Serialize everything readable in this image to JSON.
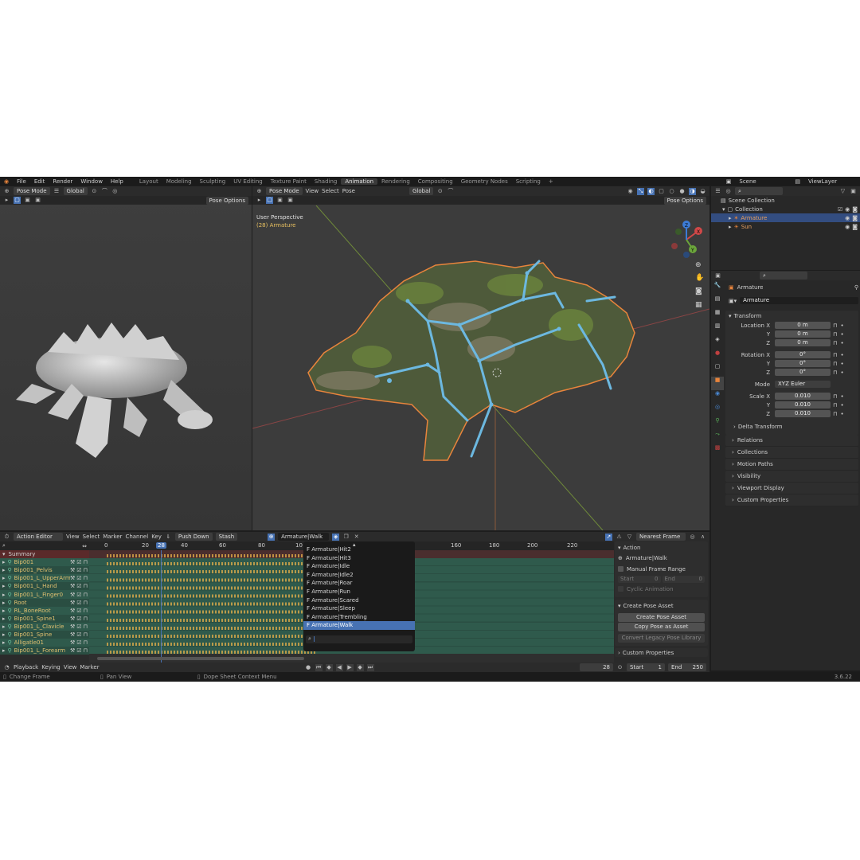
{
  "menu": {
    "items": [
      "File",
      "Edit",
      "Render",
      "Window",
      "Help"
    ],
    "workspaces": [
      "Layout",
      "Modeling",
      "Sculpting",
      "UV Editing",
      "Texture Paint",
      "Shading",
      "Animation",
      "Rendering",
      "Compositing",
      "Geometry Nodes",
      "Scripting"
    ],
    "active_workspace": "Animation",
    "plus": "+",
    "scene": "Scene",
    "view_layer": "ViewLayer"
  },
  "left_view": {
    "mode": "Pose Mode",
    "orientation": "Global",
    "pose_options": "Pose Options"
  },
  "main_view": {
    "mode": "Pose Mode",
    "menus": [
      "View",
      "Select",
      "Pose"
    ],
    "orientation": "Global",
    "pose_options": "Pose Options",
    "perspective": "User Perspective",
    "object_label": "(28) Armature",
    "axis": {
      "x": "X",
      "y": "Y",
      "z": "Z"
    }
  },
  "outliner": {
    "scene_collection": "Scene Collection",
    "collection": "Collection",
    "items": [
      "Armature",
      "Sun"
    ]
  },
  "properties": {
    "object_name": "Armature",
    "data_name": "Armature",
    "transform_title": "Transform",
    "location": {
      "label": "Location X",
      "y": "Y",
      "z": "Z",
      "values": [
        "0 m",
        "0 m",
        "0 m"
      ]
    },
    "rotation": {
      "label": "Rotation X",
      "y": "Y",
      "z": "Z",
      "values": [
        "0°",
        "0°",
        "0°"
      ]
    },
    "mode_label": "Mode",
    "mode_value": "XYZ Euler",
    "scale": {
      "label": "Scale X",
      "y": "Y",
      "z": "Z",
      "values": [
        "0.010",
        "0.010",
        "0.010"
      ]
    },
    "panels": [
      "Delta Transform",
      "Relations",
      "Collections",
      "Motion Paths",
      "Visibility",
      "Viewport Display",
      "Custom Properties"
    ]
  },
  "dopesheet": {
    "editor": "Action Editor",
    "menus": [
      "View",
      "Select",
      "Marker",
      "Channel",
      "Key"
    ],
    "push_down": "Push Down",
    "stash": "Stash",
    "action": "Armature|Walk",
    "snap": "Nearest Frame",
    "ruler": [
      "0",
      "20",
      "28",
      "40",
      "60",
      "80",
      "10",
      "160",
      "180",
      "200",
      "220",
      "240"
    ],
    "channels": [
      "Summary",
      "Bip001",
      "Bip001_Pelvis",
      "Bip001_L_UpperArm",
      "Bip001_L_Hand",
      "Bip001_L_Finger0",
      "Root",
      "RL_BoneRoot",
      "Bip001_Spine1",
      "Bip001_L_Clavicle",
      "Bip001_Spine",
      "Alligatle01",
      "Bip001_L_Forearm"
    ]
  },
  "action_dropdown": {
    "items": [
      "F Armature|Hit2",
      "F Armature|Hit3",
      "F Armature|Idle",
      "F Armature|Idle2",
      "F Armature|Roar",
      "F Armature|Run",
      "F Armature|Scared",
      "F Armature|Sleep",
      "F Armature|Trembling",
      "F Armature|Walk"
    ],
    "selected_index": 9
  },
  "side_panel": {
    "action_title": "Action",
    "action_name": "Armature|Walk",
    "manual_range": "Manual Frame Range",
    "start_label": "Start",
    "start_val": "0",
    "end_label": "End",
    "end_val": "0",
    "cyclic": "Cyclic Animation",
    "create_pose_title": "Create Pose Asset",
    "create_pose_btn": "Create Pose Asset",
    "copy_pose_btn": "Copy Pose as Asset",
    "convert_btn": "Convert Legacy Pose Library",
    "custom_props": "Custom Properties"
  },
  "timeline": {
    "menus": [
      "Playback",
      "Keying",
      "View",
      "Marker"
    ],
    "current_frame": "28",
    "start_label": "Start",
    "start": "1",
    "end_label": "End",
    "end": "250"
  },
  "status": {
    "items": [
      "Change Frame",
      "Pan View",
      "Dope Sheet Context Menu"
    ],
    "version": "3.6.22"
  },
  "colors": {
    "accent": "#4772b3",
    "orange": "#e8843c",
    "bone": "#6cb8e0"
  }
}
